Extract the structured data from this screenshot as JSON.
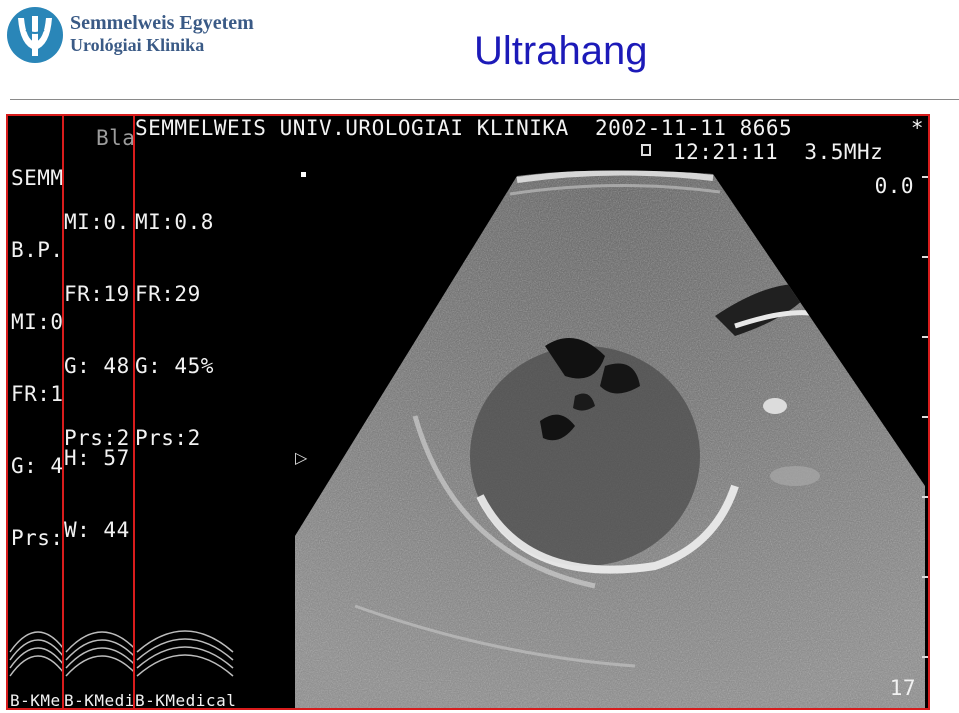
{
  "header": {
    "logo_line1": "Semmelweis Egyetem",
    "logo_line2": "Urológiai Klinika",
    "title": "Ultrahang"
  },
  "panel1": {
    "lines": [
      "SEMM",
      "B.P.",
      "MI:0",
      "FR:1",
      "G: 4",
      "Prs:"
    ],
    "footer": "B-KMe"
  },
  "panel2": {
    "top": "Bla",
    "lines": [
      "MI:0.",
      "FR:19",
      "G: 48",
      "Prs:2"
    ],
    "hw": [
      "H: 57",
      "W: 44"
    ],
    "footer": "B-KMedic"
  },
  "panel3": {
    "header_line1": "SEMMELWEIS UNIV.UROLOGIAI KLINIKA  2002-11-11 8665",
    "header_line2": "12:21:11  3.5MHz",
    "params": [
      "MI:0.8",
      "FR:29",
      "G: 45%",
      "Prs:2"
    ],
    "depth": "0.0",
    "frame": "17",
    "footer": "B-KMedical",
    "asterisk": "*"
  },
  "colors": {
    "title": "#1c1ab8",
    "panel_border": "#d81c1c",
    "logo": "#3a5a86"
  }
}
